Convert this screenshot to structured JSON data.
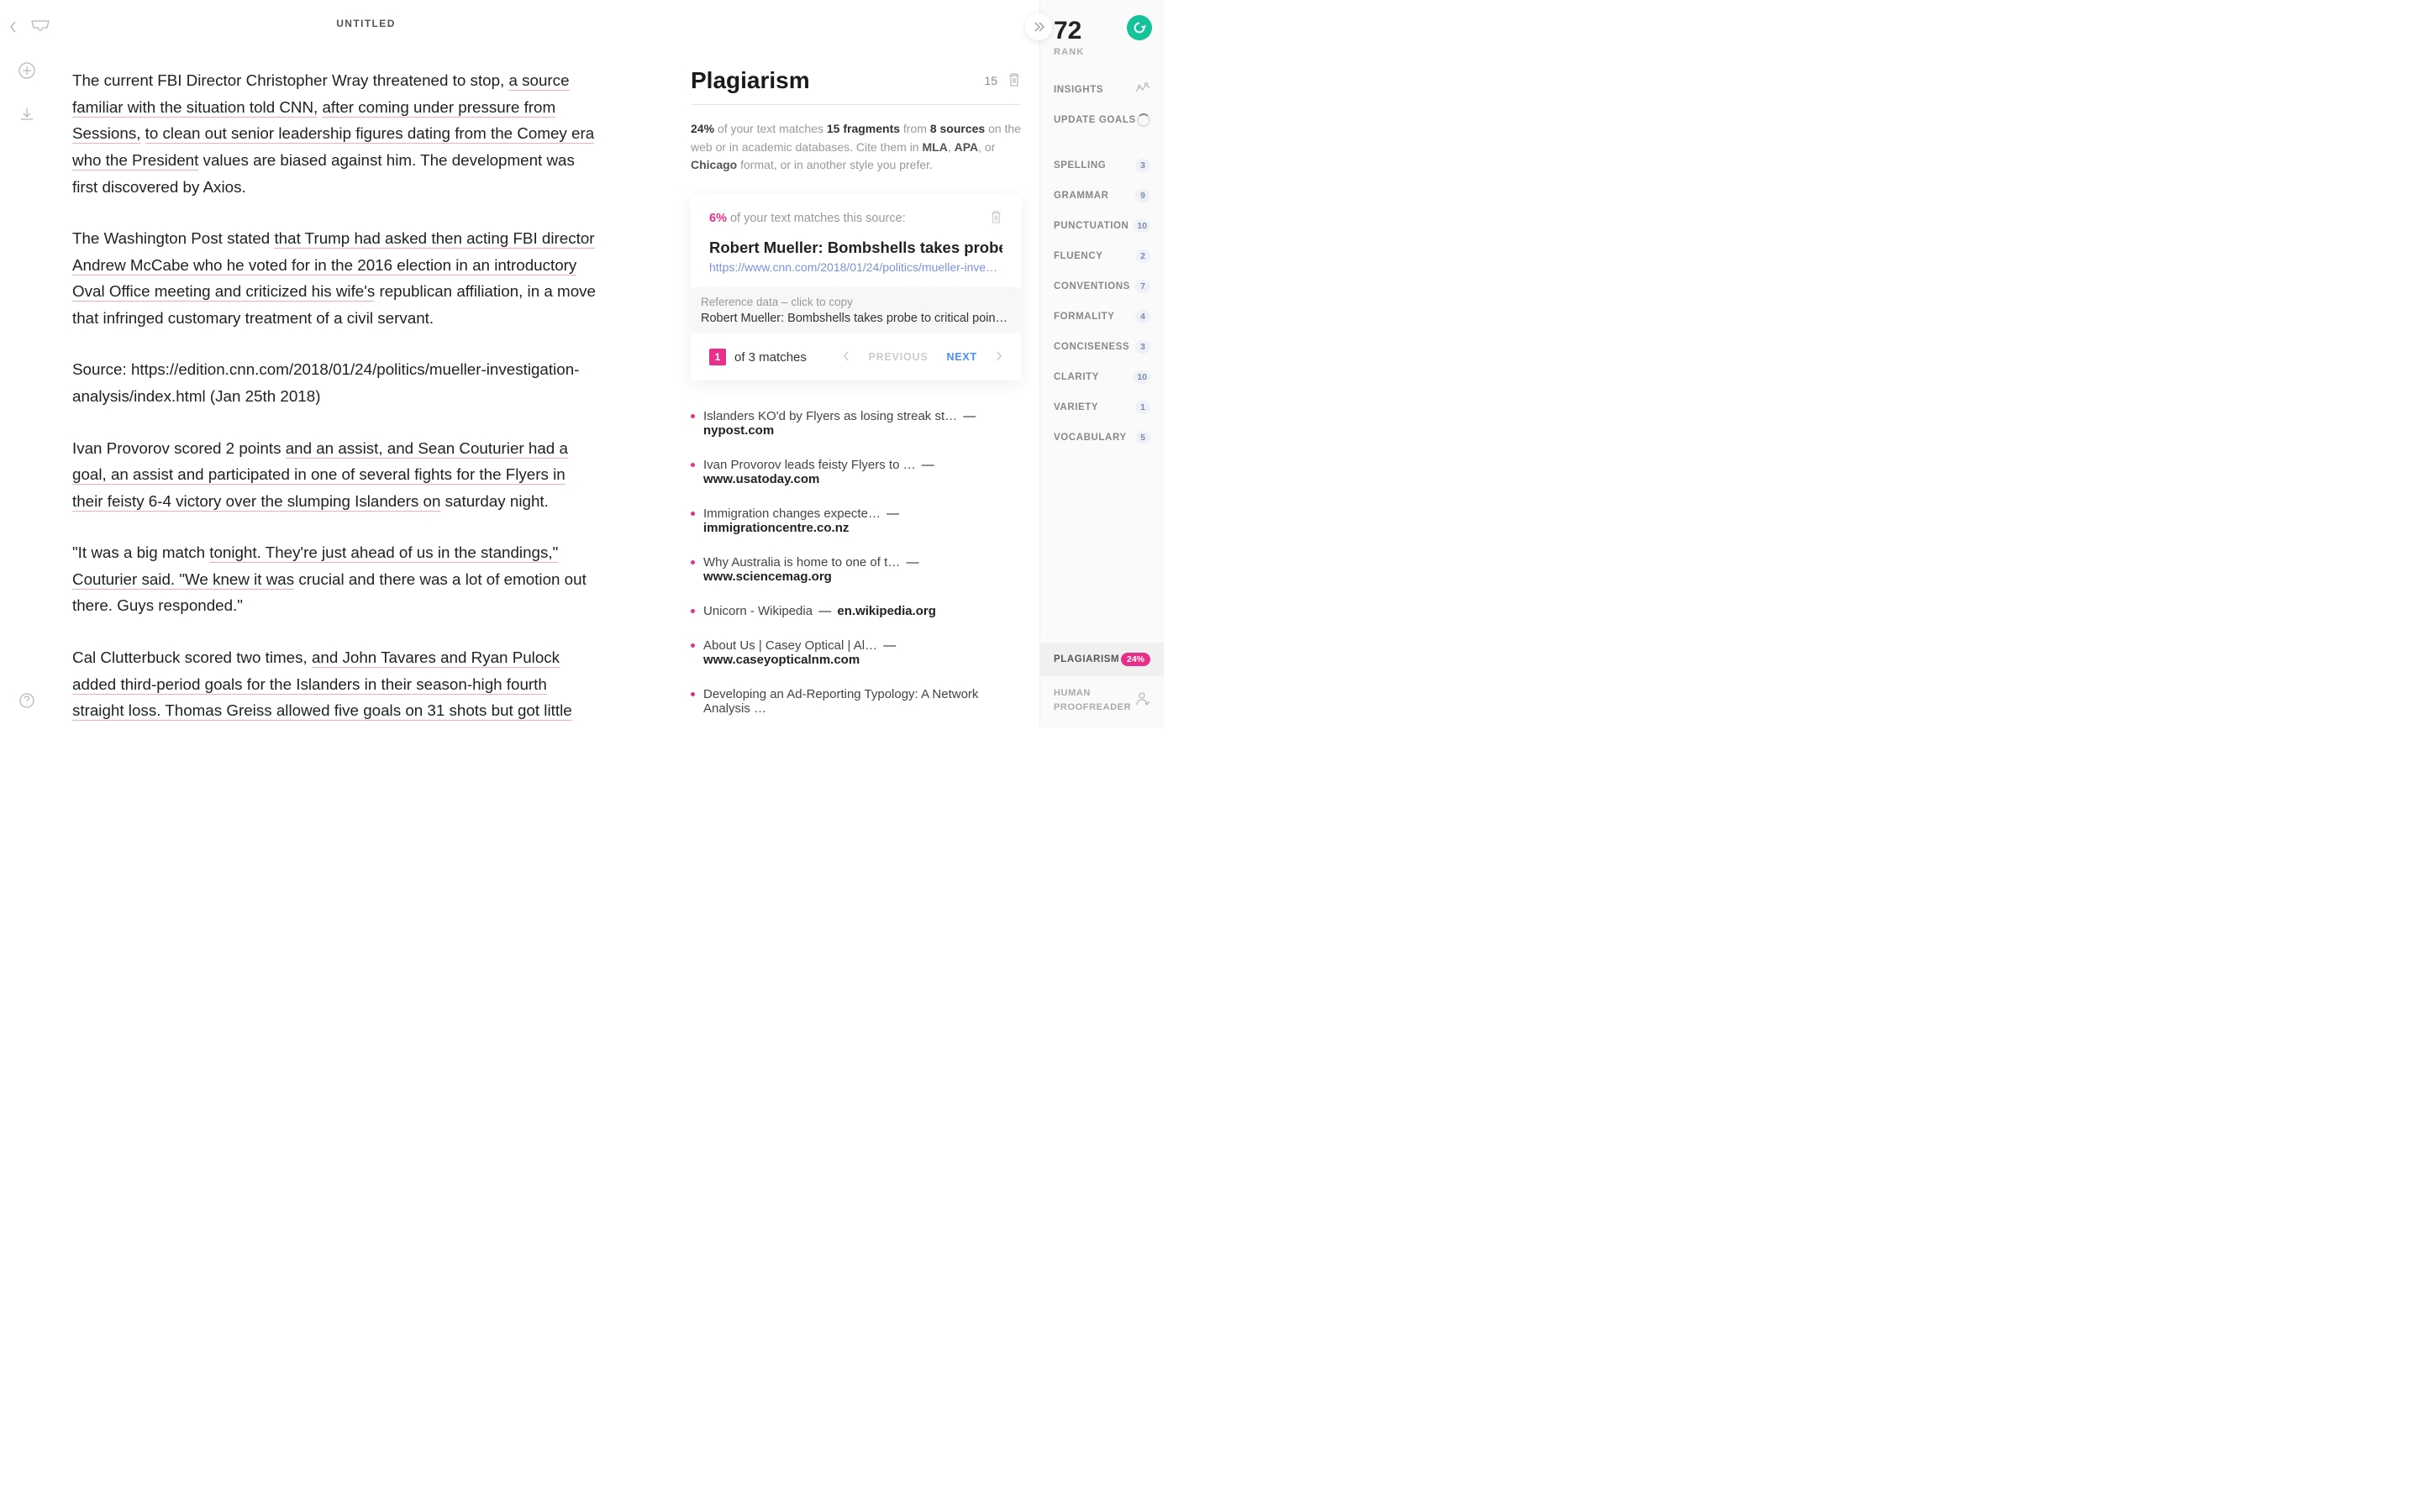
{
  "header": {
    "title": "UNTITLED"
  },
  "document": {
    "p1_pre": "The current FBI Director Christopher Wray threatened to stop, ",
    "p1_u1": "a source familiar with the situation told CNN,",
    "p1_mid1": " ",
    "p1_u2": "after coming under pressure from Sessions,",
    "p1_mid2": " ",
    "p1_u3": "to clean out senior leadership figures dating from the Comey era who the President",
    "p1_post": " values are biased against him. The development was first discovered by Axios.",
    "p2_pre": "The Washington Post stated ",
    "p2_u1": "that Trump had asked then acting FBI director Andrew McCabe who he voted for in the 2016 election in an introductory Oval Office meeting and criticized his wife's",
    "p2_post": " republican affiliation, in a move that infringed customary treatment of a civil servant.",
    "p3": "Source: https://edition.cnn.com/2018/01/24/politics/mueller-investigation-analysis/index.html (Jan 25th 2018)",
    "p4_pre": "Ivan Provorov scored 2 points ",
    "p4_u1": "and an assist, and Sean Couturier had a goal, an assist and participated in one of several fights for the Flyers in their feisty 6-4 victory over the slumping Islanders on",
    "p4_post": " saturday night.",
    "p5_pre": "\"It was a big match ",
    "p5_u1": "tonight. They're just ahead of us in the standings,\" Couturier said. \"We knew it was",
    "p5_post": " crucial and there was a lot of emotion out there. Guys responded.\"",
    "p6_pre": "Cal Clutterbuck scored two times, ",
    "p6_u1": "and John Tavares and Ryan Pulock added third-period goals for the Islanders in their season-high fourth straight loss. Thomas Greiss allowed five goals on 31 shots but got little"
  },
  "plagiarism": {
    "title": "Plagiarism",
    "header_count": "15",
    "summary_pct": "24%",
    "summary_t1": " of your text matches ",
    "summary_frag": "15 fragments",
    "summary_t2": " from ",
    "summary_src": "8 sources",
    "summary_t3": " on the web or in academic databases. Cite them in ",
    "mla": "MLA",
    "comma1": ", ",
    "apa": "APA",
    "comma2": ", or ",
    "chicago": "Chicago",
    "summary_t4": " format, or in another style you prefer.",
    "match": {
      "pct": "6%",
      "pct_text": " of your text matches this source:",
      "title": "Robert Mueller: Bombshells takes probe to cr",
      "url": "https://www.cnn.com/2018/01/24/politics/mueller-inve…",
      "ref_label": "Reference data – click to copy",
      "ref_text": "Robert Mueller: Bombshells takes probe to critical point .… ht…",
      "badge": "1",
      "of_text": "of 3 matches",
      "prev": "PREVIOUS",
      "next": "NEXT"
    },
    "sources": [
      {
        "title": "Islanders KO'd by Flyers as losing streak st…",
        "domain": "nypost.com"
      },
      {
        "title": "Ivan Provorov leads feisty Flyers to …",
        "domain": "www.usatoday.com"
      },
      {
        "title": "Immigration changes expecte…",
        "domain": "immigrationcentre.co.nz"
      },
      {
        "title": "Why Australia is home to one of t…",
        "domain": "www.sciencemag.org"
      },
      {
        "title": "Unicorn - Wikipedia",
        "domain": "en.wikipedia.org"
      },
      {
        "title": "About Us | Casey Optical | Al…",
        "domain": "www.caseyopticalnm.com"
      },
      {
        "title": "Developing an Ad-Reporting Typology: A Network Analysis …",
        "domain": ""
      }
    ]
  },
  "sidebar": {
    "rank": "72",
    "rank_label": "RANK",
    "insights": "INSIGHTS",
    "update_goals": "UPDATE GOALS",
    "stats": [
      {
        "label": "SPELLING",
        "count": "3"
      },
      {
        "label": "GRAMMAR",
        "count": "9"
      },
      {
        "label": "PUNCTUATION",
        "count": "10"
      },
      {
        "label": "FLUENCY",
        "count": "2"
      },
      {
        "label": "CONVENTIONS",
        "count": "7"
      },
      {
        "label": "FORMALITY",
        "count": "4"
      },
      {
        "label": "CONCISENESS",
        "count": "3"
      },
      {
        "label": "CLARITY",
        "count": "10"
      },
      {
        "label": "VARIETY",
        "count": "1"
      },
      {
        "label": "VOCABULARY",
        "count": "5"
      }
    ],
    "plagiarism_label": "PLAGIARISM",
    "plagiarism_pct": "24%",
    "proofreader": "HUMAN PROOFREADER"
  }
}
